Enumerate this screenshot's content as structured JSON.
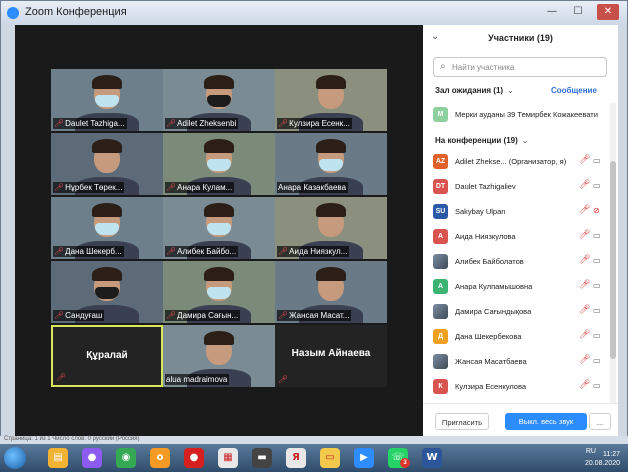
{
  "window": {
    "title": "Zoom Конференция",
    "minimize": "—",
    "maximize": "☐",
    "close": "✕"
  },
  "video_tiles": [
    {
      "name": "Daulet Tazhiga...",
      "mask": "light",
      "muted": true
    },
    {
      "name": "Adilet Zheksenbi",
      "mask": "dark",
      "muted": true
    },
    {
      "name": "Кулзира Есенк...",
      "mask": "none",
      "muted": true
    },
    {
      "name": "Нұрбек Төрек...",
      "mask": "none",
      "muted": true
    },
    {
      "name": "Анара Кулам...",
      "mask": "light",
      "muted": true
    },
    {
      "name": "Анара Казакбаева",
      "mask": "light",
      "muted": false
    },
    {
      "name": "Дана Шекерб...",
      "mask": "light",
      "muted": true
    },
    {
      "name": "Алибек Байбо...",
      "mask": "light",
      "muted": true
    },
    {
      "name": "Аида Ниязкул...",
      "mask": "none",
      "muted": true
    },
    {
      "name": "Сандуғаш",
      "mask": "dark",
      "muted": true
    },
    {
      "name": "Дамира Сағын...",
      "mask": "light",
      "muted": true
    },
    {
      "name": "Жансая Масат...",
      "mask": "none",
      "muted": true
    },
    {
      "name": "",
      "display": "Құралай",
      "muted": true,
      "active": true
    },
    {
      "name": "alua madraimova",
      "mask": "none",
      "muted": false
    },
    {
      "name": "",
      "display": "Назым Айнаева",
      "muted": true
    }
  ],
  "panel": {
    "title": "Участники (19)",
    "search_placeholder": "Найти участника",
    "waiting_label": "Зал ожидания (1)",
    "message_link": "Сообщение",
    "waiting_person": {
      "initial": "М",
      "name": "Мерки ауданы 39 Темирбек Кожакеевати",
      "color": "#8fd19e"
    },
    "conference_label": "На конференции (19)",
    "participants": [
      {
        "initials": "AZ",
        "color": "#e0622a",
        "name": "Adilet Zhekse...  (Организатор, я)",
        "cam_off": false
      },
      {
        "initials": "DT",
        "color": "#d9534f",
        "name": "Daulet Tazhigaliev",
        "cam_off": false
      },
      {
        "initials": "SU",
        "color": "#2b5aa8",
        "name": "Sakybay Ulpan",
        "cam_off": true
      },
      {
        "initials": "А",
        "color": "#d9534f",
        "name": "Аида Ниязкулова",
        "cam_off": false
      },
      {
        "initials": "",
        "color": "photo",
        "name": "Алибек Байболатов",
        "cam_off": false
      },
      {
        "initials": "А",
        "color": "#3cb371",
        "name": "Анара Кулпамышовна",
        "cam_off": false
      },
      {
        "initials": "",
        "color": "photo",
        "name": "Дамира Сағындықова",
        "cam_off": false
      },
      {
        "initials": "Д",
        "color": "#f0a020",
        "name": "Дана Шекербекова",
        "cam_off": false
      },
      {
        "initials": "",
        "color": "photo",
        "name": "Жансая Масатбаева",
        "cam_off": false
      },
      {
        "initials": "К",
        "color": "#d9534f",
        "name": "Кулзира Есенкулова",
        "cam_off": false
      }
    ],
    "invite_button": "Пригласить",
    "mute_all_button": "Выкл. весь звук",
    "more_button": "..."
  },
  "status_bar": {
    "text": "Страница: 1 из 1    Число слов: 0    русский (Россия)"
  },
  "taskbar": {
    "language": "RU",
    "time": "11:27",
    "date": "20.08.2020",
    "apps": [
      {
        "icon": "explorer-icon",
        "glyph": "▤",
        "color": "#f2b233"
      },
      {
        "icon": "alice-icon",
        "glyph": "●",
        "color": "#8c5cf0"
      },
      {
        "icon": "chrome-icon",
        "glyph": "◉",
        "color": "#34a853"
      },
      {
        "icon": "odnoklassniki-icon",
        "glyph": "о",
        "color": "#f59a23"
      },
      {
        "icon": "record-icon",
        "glyph": "●",
        "color": "#d62020"
      },
      {
        "icon": "calculator-icon",
        "glyph": "▦",
        "color": "#e8e8e8"
      },
      {
        "icon": "media-icon",
        "glyph": "▬",
        "color": "#444444"
      },
      {
        "icon": "yandex-icon",
        "glyph": "Я",
        "color": "#e8e8e8"
      },
      {
        "icon": "folder-icon",
        "glyph": "▭",
        "color": "#f2c94c"
      },
      {
        "icon": "zoom-icon",
        "glyph": "▶",
        "color": "#2d8cff"
      },
      {
        "icon": "whatsapp-icon",
        "glyph": "☏",
        "color": "#25d366"
      },
      {
        "icon": "word-icon",
        "glyph": "W",
        "color": "#2b579a"
      }
    ],
    "badge": "3"
  }
}
